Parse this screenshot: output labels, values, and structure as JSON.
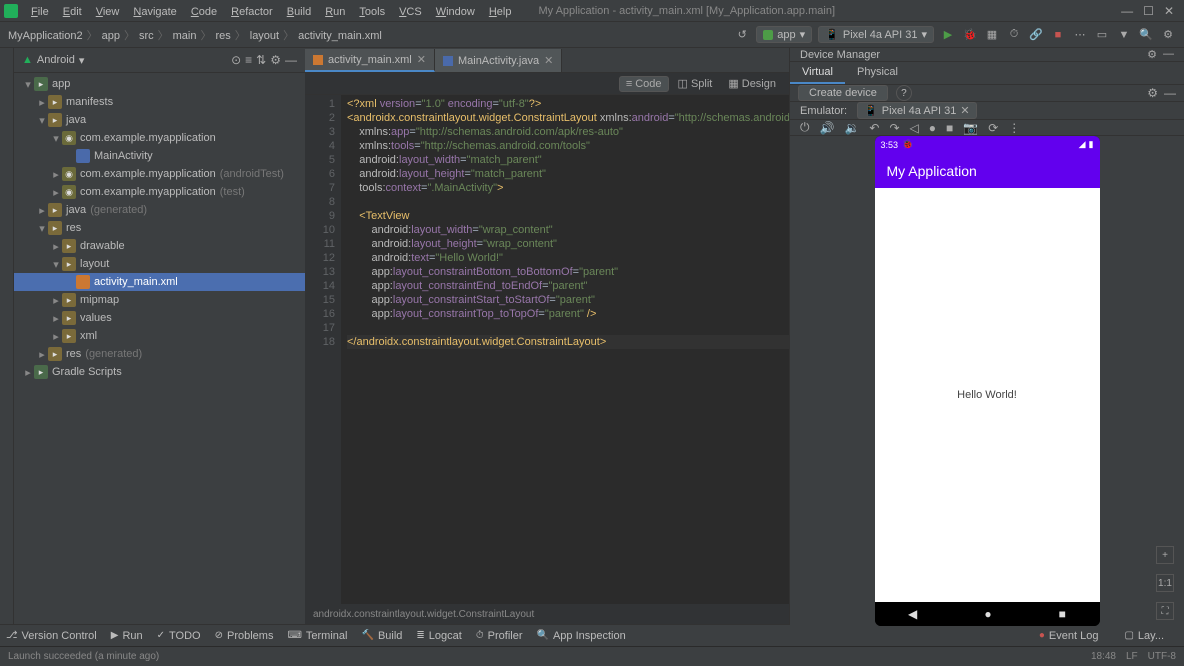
{
  "menu": {
    "items": [
      "File",
      "Edit",
      "View",
      "Navigate",
      "Code",
      "Refactor",
      "Build",
      "Run",
      "Tools",
      "VCS",
      "Window",
      "Help"
    ],
    "title": "My Application - activity_main.xml [My_Application.app.main]"
  },
  "breadcrumb": {
    "parts": [
      "MyApplication2",
      "app",
      "src",
      "main",
      "res",
      "layout",
      "activity_main.xml"
    ],
    "run_config": "app",
    "device": "Pixel 4a API 31"
  },
  "project": {
    "view": "Android",
    "tree": [
      {
        "depth": 0,
        "arrow": "▾",
        "icon": "folder-g",
        "label": "app"
      },
      {
        "depth": 1,
        "arrow": "▸",
        "icon": "folder",
        "label": "manifests"
      },
      {
        "depth": 1,
        "arrow": "▾",
        "icon": "folder",
        "label": "java"
      },
      {
        "depth": 2,
        "arrow": "▾",
        "icon": "pkg",
        "label": "com.example.myapplication"
      },
      {
        "depth": 3,
        "arrow": "",
        "icon": "kt",
        "label": "MainActivity"
      },
      {
        "depth": 2,
        "arrow": "▸",
        "icon": "pkg",
        "label": "com.example.myapplication",
        "dim": "(androidTest)"
      },
      {
        "depth": 2,
        "arrow": "▸",
        "icon": "pkg",
        "label": "com.example.myapplication",
        "dim": "(test)"
      },
      {
        "depth": 1,
        "arrow": "▸",
        "icon": "folder",
        "label": "java",
        "dim": "(generated)"
      },
      {
        "depth": 1,
        "arrow": "▾",
        "icon": "folder",
        "label": "res"
      },
      {
        "depth": 2,
        "arrow": "▸",
        "icon": "folder",
        "label": "drawable"
      },
      {
        "depth": 2,
        "arrow": "▾",
        "icon": "folder",
        "label": "layout"
      },
      {
        "depth": 3,
        "arrow": "",
        "icon": "file",
        "label": "activity_main.xml",
        "sel": true
      },
      {
        "depth": 2,
        "arrow": "▸",
        "icon": "folder",
        "label": "mipmap"
      },
      {
        "depth": 2,
        "arrow": "▸",
        "icon": "folder",
        "label": "values"
      },
      {
        "depth": 2,
        "arrow": "▸",
        "icon": "folder",
        "label": "xml"
      },
      {
        "depth": 1,
        "arrow": "▸",
        "icon": "folder",
        "label": "res",
        "dim": "(generated)"
      },
      {
        "depth": 0,
        "arrow": "▸",
        "icon": "folder-g",
        "label": "Gradle Scripts"
      }
    ]
  },
  "tabs": [
    {
      "label": "activity_main.xml",
      "icon": "file",
      "active": true
    },
    {
      "label": "MainActivity.java",
      "icon": "kt",
      "active": false
    }
  ],
  "view_modes": {
    "code": "Code",
    "split": "Split",
    "design": "Design",
    "active": "Code"
  },
  "editor_breadcrumb": "androidx.constraintlayout.widget.ConstraintLayout",
  "code_lines": [
    {
      "n": 1,
      "html": "<span class='t-tag'>&lt;?xml</span> <span class='t-attr'>version</span><span class='t-eq'>=</span><span class='t-str'>\"1.0\"</span> <span class='t-attr'>encoding</span><span class='t-eq'>=</span><span class='t-str'>\"utf-8\"</span><span class='t-tag'>?&gt;</span>"
    },
    {
      "n": 2,
      "html": "<span class='t-tag'>&lt;androidx.constraintlayout.widget.ConstraintLayout</span> <span class='t-prefix'>xmlns:</span><span class='t-attr'>android</span><span class='t-eq'>=</span><span class='t-str'>\"http://schemas.android.com/apk/res/android\"</span>"
    },
    {
      "n": 3,
      "html": "    <span class='t-prefix'>xmlns:</span><span class='t-attr'>app</span><span class='t-eq'>=</span><span class='t-str'>\"http://schemas.android.com/apk/res-auto\"</span>"
    },
    {
      "n": 4,
      "html": "    <span class='t-prefix'>xmlns:</span><span class='t-attr'>tools</span><span class='t-eq'>=</span><span class='t-str'>\"http://schemas.android.com/tools\"</span>"
    },
    {
      "n": 5,
      "html": "    <span class='t-prefix'>android:</span><span class='t-attr'>layout_width</span><span class='t-eq'>=</span><span class='t-str'>\"match_parent\"</span>"
    },
    {
      "n": 6,
      "html": "    <span class='t-prefix'>android:</span><span class='t-attr'>layout_height</span><span class='t-eq'>=</span><span class='t-str'>\"match_parent\"</span>"
    },
    {
      "n": 7,
      "html": "    <span class='t-prefix'>tools:</span><span class='t-attr'>context</span><span class='t-eq'>=</span><span class='t-str'>\".MainActivity\"</span><span class='t-tag'>&gt;</span>"
    },
    {
      "n": 8,
      "html": ""
    },
    {
      "n": 9,
      "html": "    <span class='t-tag'>&lt;TextView</span>"
    },
    {
      "n": 10,
      "html": "        <span class='t-prefix'>android:</span><span class='t-attr'>layout_width</span><span class='t-eq'>=</span><span class='t-str'>\"wrap_content\"</span>"
    },
    {
      "n": 11,
      "html": "        <span class='t-prefix'>android:</span><span class='t-attr'>layout_height</span><span class='t-eq'>=</span><span class='t-str'>\"wrap_content\"</span>"
    },
    {
      "n": 12,
      "html": "        <span class='t-prefix'>android:</span><span class='t-attr'>text</span><span class='t-eq'>=</span><span class='t-str'>\"Hello World!\"</span>"
    },
    {
      "n": 13,
      "html": "        <span class='t-prefix'>app:</span><span class='t-attr'>layout_constraintBottom_toBottomOf</span><span class='t-eq'>=</span><span class='t-str'>\"parent\"</span>"
    },
    {
      "n": 14,
      "html": "        <span class='t-prefix'>app:</span><span class='t-attr'>layout_constraintEnd_toEndOf</span><span class='t-eq'>=</span><span class='t-str'>\"parent\"</span>"
    },
    {
      "n": 15,
      "html": "        <span class='t-prefix'>app:</span><span class='t-attr'>layout_constraintStart_toStartOf</span><span class='t-eq'>=</span><span class='t-str'>\"parent\"</span>"
    },
    {
      "n": 16,
      "html": "        <span class='t-prefix'>app:</span><span class='t-attr'>layout_constraintTop_toTopOf</span><span class='t-eq'>=</span><span class='t-str'>\"parent\"</span> <span class='t-tag'>/&gt;</span>"
    },
    {
      "n": 17,
      "html": ""
    },
    {
      "n": 18,
      "html": "<span class='t-tag'>&lt;/androidx.constraintlayout.widget.ConstraintLayout&gt;</span>",
      "hl": true
    }
  ],
  "device_mgr": {
    "title": "Device Manager",
    "tabs": [
      "Virtual",
      "Physical"
    ],
    "active_tab": "Virtual",
    "create": "Create device",
    "emulator_label": "Emulator:",
    "emulator_name": "Pixel 4a API 31"
  },
  "phone": {
    "time": "3:53",
    "app_title": "My Application",
    "body_text": "Hello World!",
    "zoom": "1:1"
  },
  "bottom": {
    "items": [
      "Version Control",
      "Run",
      "TODO",
      "Problems",
      "Terminal",
      "Build",
      "Logcat",
      "Profiler",
      "App Inspection"
    ],
    "event_log": "Event Log",
    "layout_inspector": "Lay..."
  },
  "status": {
    "msg": "Launch succeeded (a minute ago)",
    "pos": "18:48",
    "le": "LF",
    "enc": "UTF-8"
  }
}
